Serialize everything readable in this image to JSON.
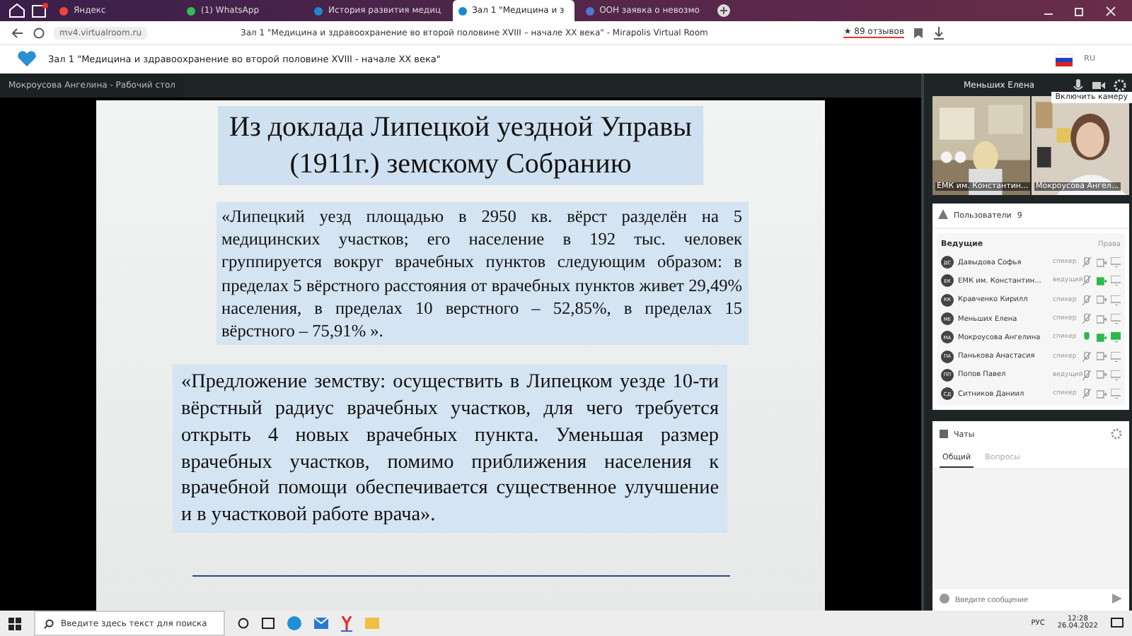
{
  "browser": {
    "tabs": [
      {
        "label": "Яндекс",
        "selected": false
      },
      {
        "label": "(1) WhatsApp",
        "selected": false
      },
      {
        "label": "История развития медиц",
        "selected": false
      },
      {
        "label": "Зал 1 \"Медицина и з",
        "selected": true
      },
      {
        "label": "ООН заявка о невозмо",
        "selected": false
      }
    ],
    "address": "mv4.virtualroom.ru",
    "page_title": "Зал 1 \"Медицина и здравоохранение во второй половине XVIII – начале XX века\" - Mirapolis Virtual Room",
    "reviews": "★ 89 отзывов"
  },
  "room": {
    "title": "Зал 1 \"Медицина и здравоохранение во второй половине XVIII - начале XX века\"",
    "language": "RU"
  },
  "stage": {
    "title": "Мокроусова Ангелина - Рабочий стол",
    "slide": {
      "title_lines": [
        "Из доклада Липецкой уездной Управы",
        "(1911г.) земскому Собранию"
      ],
      "paragraphs": [
        "«Липецкий уезд площадью в 2950 кв. вёрст разделён на 5 медицинских участков; его население в 192 тыс. человек группируется вокруг врачебных пунктов следующим образом: в пределах 5 вёрстного расстояния от врачебных пунктов живет 29,49% населения, в пределах 10 верстного – 52,85%, в пределах 15 вёрстного – 75,91% ».",
        "«Предложение земству: осуществить в Липецком уезде 10-ти вёрстный радиус врачебных участков, для чего требуется открыть 4 новых врачебных пункта. Уменьшая размер врачебных участков, помимо приближения населения к врачебной помощи обеспечивается существенное улучшение и в участковой работе врача»."
      ]
    }
  },
  "panel": {
    "user": "Меньших Елена",
    "tooltip": "Включить камеру",
    "videos": [
      {
        "label": "ЕМК им. Константин..."
      },
      {
        "label": "Мокроусова Ангел..."
      }
    ],
    "users_title": "Пользователи",
    "users_count": "9",
    "group": "Ведущие",
    "rights": "Права",
    "users": [
      {
        "initials": "ДС",
        "name": "Давыдова Софья",
        "role": "спикер",
        "mic": false,
        "camera": false,
        "screen": false
      },
      {
        "initials": "ЕК",
        "name": "ЕМК им. Константин...",
        "role": "ведущий",
        "mic": false,
        "camera": true,
        "screen": false
      },
      {
        "initials": "КК",
        "name": "Кравченко Кирилл",
        "role": "спикер",
        "mic": false,
        "camera": false,
        "screen": false
      },
      {
        "initials": "МЕ",
        "name": "Меньших Елена",
        "role": "спикер",
        "mic": false,
        "camera": false,
        "screen": false
      },
      {
        "initials": "МА",
        "name": "Мокроусова Ангелина",
        "role": "спикер",
        "mic": true,
        "camera": true,
        "screen": true
      },
      {
        "initials": "ПА",
        "name": "Панькова Анастасия",
        "role": "спикер",
        "mic": false,
        "camera": false,
        "screen": false
      },
      {
        "initials": "ПП",
        "name": "Попов Павел",
        "role": "ведущий",
        "mic": false,
        "camera": false,
        "screen": false
      },
      {
        "initials": "СД",
        "name": "Ситников Даниил",
        "role": "спикер",
        "mic": false,
        "camera": false,
        "screen": false
      }
    ],
    "chat_title": "Чаты",
    "chat_tabs": [
      {
        "label": "Общий",
        "selected": true
      },
      {
        "label": "Вопросы",
        "selected": false
      }
    ],
    "message_placeholder": "Введите сообщение"
  },
  "taskbar": {
    "search_placeholder": "Введите здесь текст для поиска",
    "language": "РУС",
    "time": "12:28",
    "date": "26.04.2022"
  }
}
